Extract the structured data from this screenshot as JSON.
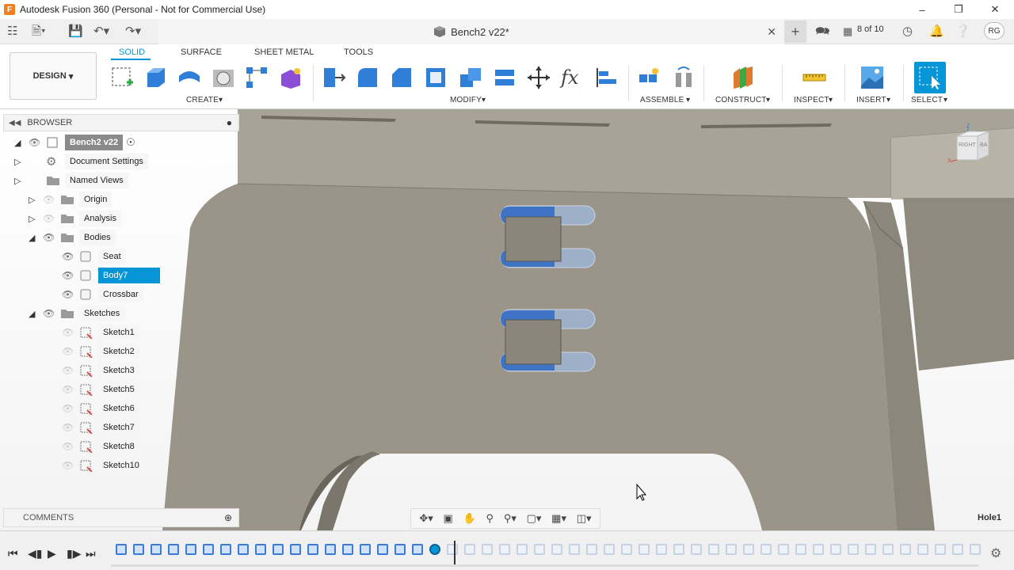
{
  "window": {
    "title": "Autodesk Fusion 360 (Personal - Not for Commercial Use)",
    "logo_letter": "F"
  },
  "document": {
    "tab_title": "Bench2 v22*",
    "jobs_count": "8 of 10",
    "user_initials": "RG"
  },
  "workspace": {
    "label": "DESIGN"
  },
  "toolbar": {
    "tabs": [
      "SOLID",
      "SURFACE",
      "SHEET METAL",
      "TOOLS"
    ],
    "active_tab": "SOLID",
    "groups": [
      "CREATE",
      "MODIFY",
      "ASSEMBLE",
      "CONSTRUCT",
      "INSPECT",
      "INSERT",
      "SELECT"
    ]
  },
  "browser": {
    "title": "BROWSER",
    "root": "Bench2 v22",
    "items": [
      {
        "label": "Document Settings"
      },
      {
        "label": "Named Views"
      },
      {
        "label": "Origin"
      },
      {
        "label": "Analysis"
      },
      {
        "label": "Bodies"
      },
      {
        "label": "Seat"
      },
      {
        "label": "Body7"
      },
      {
        "label": "Crossbar"
      },
      {
        "label": "Sketches"
      },
      {
        "label": "Sketch1"
      },
      {
        "label": "Sketch2"
      },
      {
        "label": "Sketch3"
      },
      {
        "label": "Sketch5"
      },
      {
        "label": "Sketch6"
      },
      {
        "label": "Sketch7"
      },
      {
        "label": "Sketch8"
      },
      {
        "label": "Sketch10"
      }
    ],
    "selected_item": "Body7"
  },
  "comments": {
    "label": "COMMENTS"
  },
  "viewcube": {
    "face_label": "RIGHT",
    "back_label": "BA",
    "axis_z": "Z",
    "axis_x": "X"
  },
  "feature_tooltip": "Hole1",
  "colors": {
    "accent": "#0696d7",
    "model_gray": "#9a9588",
    "timeline_blue": "#3a7bd5"
  }
}
